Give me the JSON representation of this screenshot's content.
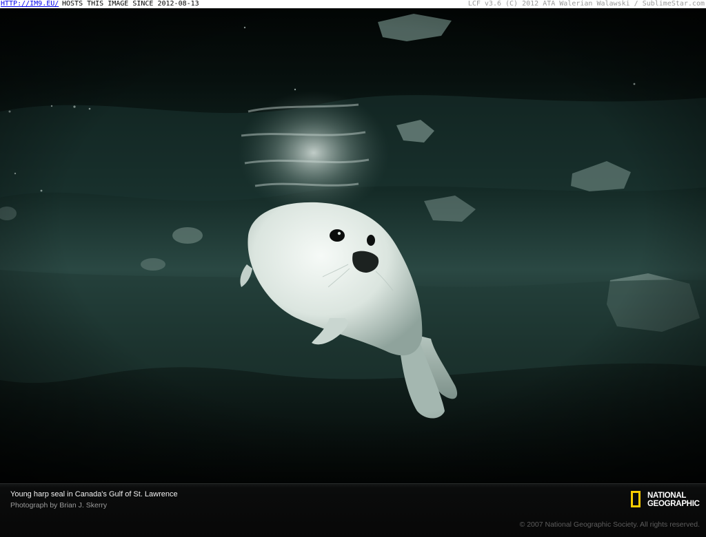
{
  "watermark": {
    "link_text": "HTTP://IM9.EU/",
    "hosts_text": "HOSTS THIS IMAGE SINCE 2012-08-13",
    "credit_text": "LCF v3.6 (C) 2012 ATA Walerian Walawski / SublimeStar.com"
  },
  "photo": {
    "subject": "harp-seal-pup-underwater"
  },
  "caption": {
    "title": "Young harp seal in Canada's Gulf of St. Lawrence",
    "credit": "Photograph by Brian J. Skerry",
    "copyright": "© 2007 National Geographic Society. All rights reserved."
  },
  "logo": {
    "line1": "NATIONAL",
    "line2": "GEOGRAPHIC",
    "frame_color": "#ffce00"
  },
  "colors": {
    "link": "#0000ee",
    "water_dark": "#050a09",
    "water_teal": "#2c4a44",
    "seal_fur": "#e4ebe6"
  }
}
